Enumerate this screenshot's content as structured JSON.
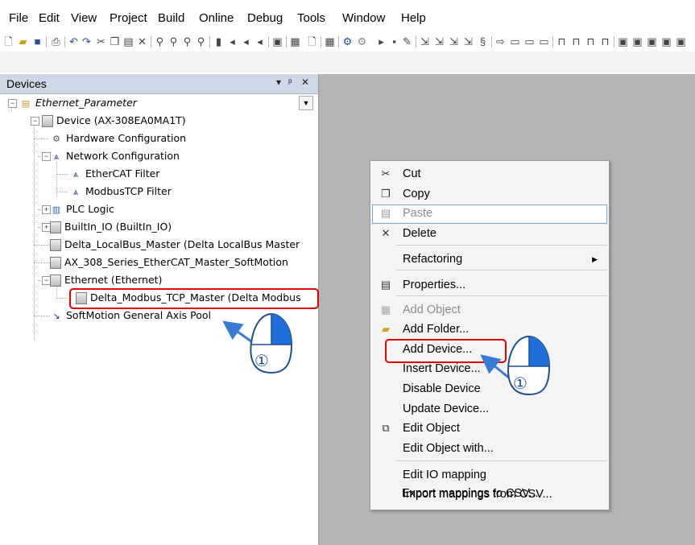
{
  "menubar": {
    "items": [
      "File",
      "Edit",
      "View",
      "Project",
      "Build",
      "Online",
      "Debug",
      "Tools",
      "Window",
      "Help"
    ]
  },
  "devices_panel": {
    "title": "Devices",
    "controls": [
      "▾",
      "ᵖ",
      "✕"
    ],
    "tree": [
      {
        "label": "Ethernet_Parameter",
        "icon": "project-icon",
        "italic": true
      },
      {
        "label": "Device (AX-308EA0MA1T)",
        "icon": "device-icon"
      },
      {
        "label": "Hardware Configuration",
        "icon": "wrench-icon"
      },
      {
        "label": "Network Configuration",
        "icon": "network-icon"
      },
      {
        "label": "EtherCAT Filter",
        "icon": "network-icon"
      },
      {
        "label": "ModbusTCP Filter",
        "icon": "network-icon"
      },
      {
        "label": "PLC Logic",
        "icon": "plc-logic-icon"
      },
      {
        "label": "BuiltIn_IO (BuiltIn_IO)",
        "icon": "device-icon"
      },
      {
        "label": "Delta_LocalBus_Master (Delta LocalBus Master",
        "icon": "device-icon"
      },
      {
        "label": "AX_308_Series_EtherCAT_Master_SoftMotion",
        "icon": "device-icon"
      },
      {
        "label": "Ethernet (Ethernet)",
        "icon": "device-icon"
      },
      {
        "label": "Delta_Modbus_TCP_Master (Delta Modbus",
        "icon": "device-icon"
      },
      {
        "label": "SoftMotion General Axis Pool",
        "icon": "axis-pool-icon"
      }
    ]
  },
  "context_menu": {
    "items": [
      {
        "label": "Cut",
        "icon": "cut-icon",
        "enabled": true
      },
      {
        "label": "Copy",
        "icon": "copy-icon",
        "enabled": true
      },
      {
        "label": "Paste",
        "icon": "paste-icon",
        "enabled": false,
        "hover": true
      },
      {
        "label": "Delete",
        "icon": "delete-icon",
        "enabled": true
      },
      {
        "label": "Refactoring",
        "icon": "",
        "enabled": true,
        "submenu": true
      },
      {
        "label": "Properties...",
        "icon": "properties-icon",
        "enabled": true
      },
      {
        "label": "Add Object",
        "icon": "add-object-icon",
        "enabled": false
      },
      {
        "label": "Add Folder...",
        "icon": "folder-icon",
        "enabled": true
      },
      {
        "label": "Add Device...",
        "icon": "",
        "enabled": true,
        "highlighted_annotation": true
      },
      {
        "label": "Insert Device...",
        "icon": "",
        "enabled": true
      },
      {
        "label": "Disable Device",
        "icon": "",
        "enabled": true
      },
      {
        "label": "Update Device...",
        "icon": "",
        "enabled": true
      },
      {
        "label": "Edit Object",
        "icon": "edit-object-icon",
        "enabled": true
      },
      {
        "label": "Edit Object with...",
        "icon": "",
        "enabled": true
      },
      {
        "label": "Edit IO mapping",
        "icon": "",
        "enabled": true
      },
      {
        "label": "Import mappings from CSV...",
        "icon": "",
        "enabled": true
      },
      {
        "label": "Export mappings to CSV...",
        "icon": "",
        "enabled": true
      }
    ]
  },
  "annotations": {
    "step_label": "①",
    "highlight_color": "#e60000",
    "arrow_color": "#3a7bd5",
    "badge_fill": "#1e6fd9"
  }
}
